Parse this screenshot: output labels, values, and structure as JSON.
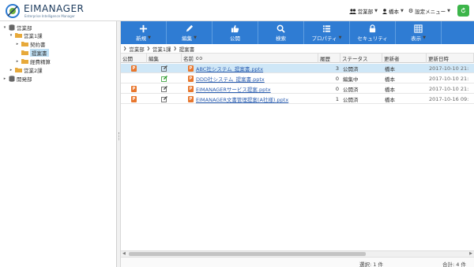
{
  "header": {
    "brand": "EIMANAGER",
    "tagline": "Enterprise Intelligence Manager",
    "dept": "営業部",
    "user": "橋本",
    "settings": "設定メニュー",
    "colors": {
      "accent": "#2f7cd3",
      "refresh": "#3cb54a"
    }
  },
  "sidebar": {
    "nodes": [
      {
        "label": "営業部",
        "icon": "database-icon",
        "arrow": "▾"
      },
      {
        "label": "営業1課",
        "icon": "folder-icon",
        "arrow": "▾"
      },
      {
        "label": "契約書",
        "icon": "folder-icon",
        "arrow": "▸"
      },
      {
        "label": "提案書",
        "icon": "folder-icon",
        "arrow": ""
      },
      {
        "label": "経費精算",
        "icon": "folder-icon",
        "arrow": "▸"
      },
      {
        "label": "営業2課",
        "icon": "folder-icon",
        "arrow": "▸"
      },
      {
        "label": "開発部",
        "icon": "database-icon",
        "arrow": "▸"
      }
    ]
  },
  "toolbar": {
    "buttons": [
      {
        "label": "新規",
        "icon": "plus-icon",
        "dropdown": true
      },
      {
        "label": "編集",
        "icon": "pencil-icon",
        "dropdown": true
      },
      {
        "label": "公開",
        "icon": "thumbs-up-icon",
        "dropdown": false
      },
      {
        "label": "検索",
        "icon": "search-icon",
        "dropdown": false
      },
      {
        "label": "プロパティ",
        "icon": "list-icon",
        "dropdown": true
      },
      {
        "label": "セキュリティ",
        "icon": "lock-icon",
        "dropdown": false
      },
      {
        "label": "表示",
        "icon": "table-icon",
        "dropdown": true
      }
    ]
  },
  "breadcrumb": [
    "営業部",
    "営業1課",
    "提案書"
  ],
  "table": {
    "columns": {
      "pub": "公開",
      "edit": "編集",
      "name": "名前",
      "ver": "履歴",
      "status": "ステータス",
      "updater": "更新者",
      "date": "更新日時"
    },
    "rows": [
      {
        "name": "ABC社システム_提案書.pptx",
        "ver": "3",
        "status": "公開済",
        "updater": "橋本",
        "date": "2017-10-10 21:",
        "selected": true,
        "pub": true,
        "edit_color": "#555"
      },
      {
        "name": "DDD社システム_提案書.pptx",
        "ver": "0",
        "status": "編集中",
        "updater": "橋本",
        "date": "2017-10-10 21:",
        "selected": false,
        "pub": false,
        "edit_color": "#2e9c2e"
      },
      {
        "name": "EIMANAGERサービス提案.pptx",
        "ver": "0",
        "status": "公開済",
        "updater": "橋本",
        "date": "2017-10-10 21:",
        "selected": false,
        "pub": true,
        "edit_color": "#555"
      },
      {
        "name": "EIMANAGER文書管理提案(A社様).pptx",
        "ver": "1",
        "status": "公開済",
        "updater": "橋本",
        "date": "2017-10-16 09:",
        "selected": false,
        "pub": true,
        "edit_color": "#555"
      }
    ]
  },
  "status": {
    "selected": "選択: 1 件",
    "total": "合計: 4 件"
  }
}
